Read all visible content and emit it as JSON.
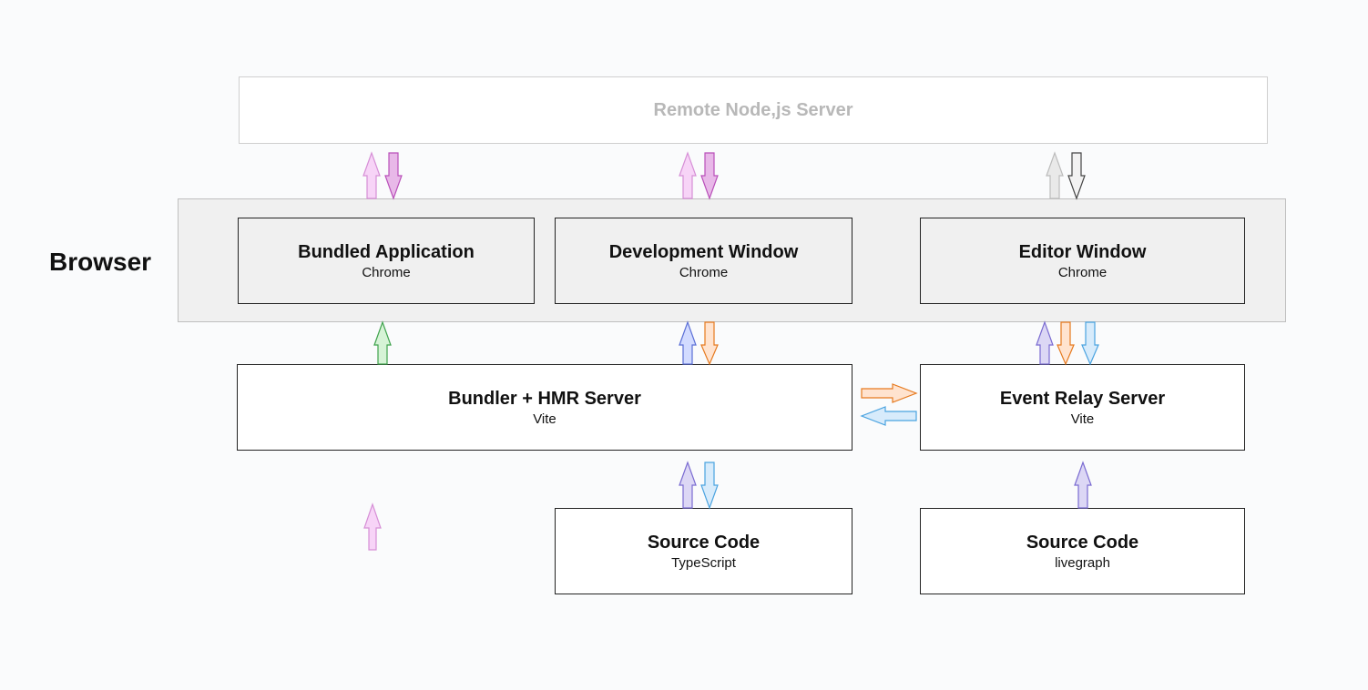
{
  "sideLabel": "Browser",
  "remote": {
    "title": "Remote Node,js Server"
  },
  "browserRow": {
    "bundled": {
      "title": "Bundled Application",
      "sub": "Chrome"
    },
    "devwin": {
      "title": "Development Window",
      "sub": "Chrome"
    },
    "editorwin": {
      "title": "Editor Window",
      "sub": "Chrome"
    }
  },
  "bundler": {
    "title": "Bundler + HMR Server",
    "sub": "Vite"
  },
  "relay": {
    "title": "Event Relay Server",
    "sub": "Vite"
  },
  "srcTs": {
    "title": "Source Code",
    "sub": "TypeScript"
  },
  "srcLg": {
    "title": "Source Code",
    "sub": "livegraph"
  },
  "colors": {
    "pinkFill": "#f7d4f7",
    "pinkStroke": "#b94fb9",
    "pink2Fill": "#f7d4f7",
    "pink2Stroke": "#b94fb9",
    "grayFill": "#e6e6e6",
    "grayStroke": "#888",
    "greenFill": "#d6f3d6",
    "greenStroke": "#3fa34d",
    "blueFill": "#d2dbff",
    "blueStroke": "#5b6fd6",
    "orangeFill": "#ffe3cf",
    "orangeStroke": "#e67a1f",
    "cyanFill": "#d7ebfb",
    "cyanStroke": "#4aa3e0",
    "purpleFill": "#dcd7f5",
    "purpleStroke": "#7a6bd1"
  }
}
